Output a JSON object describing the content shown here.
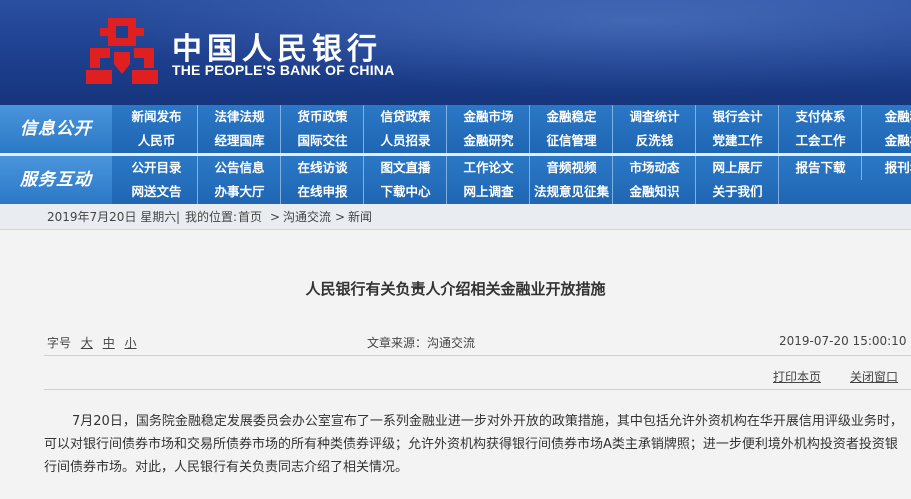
{
  "header": {
    "brand_cn": "中国人民银行",
    "brand_en": "THE PEOPLE'S BANK OF CHINA",
    "logo_icon": "pboc-logo-icon",
    "colors": {
      "banner": "#1d3f8e",
      "logo_red": "#e02020",
      "nav": "#2270bd"
    }
  },
  "nav": {
    "section1_label": "信息公开",
    "section2_label": "服务互动",
    "row1": [
      "新闻发布",
      "法律法规",
      "货币政策",
      "信贷政策",
      "金融市场",
      "金融稳定",
      "调查统计",
      "银行会计",
      "支付体系",
      "金融科"
    ],
    "row2": [
      "人民币",
      "经理国库",
      "国际交往",
      "人员招录",
      "金融研究",
      "征信管理",
      "反洗钱",
      "党建工作",
      "工会工作",
      "金融标"
    ],
    "row3": [
      "公开目录",
      "公告信息",
      "在线访谈",
      "图文直播",
      "工作论文",
      "音频视频",
      "市场动态",
      "网上展厅",
      "报告下载",
      "报刊年"
    ],
    "row4": [
      "网送文告",
      "办事大厅",
      "在线申报",
      "下载中心",
      "网上调查",
      "法规意见征集",
      "金融知识",
      "关于我们"
    ]
  },
  "breadcrumb": {
    "date": "2019年7月20日 星期六",
    "sep": "|",
    "location_label": "我的位置:",
    "home": "首页",
    "arrow": ">",
    "section": "沟通交流",
    "page": "新闻"
  },
  "article": {
    "title": "人民银行有关负责人介绍相关金融业开放措施",
    "font_size_label": "字号",
    "font_sizes": [
      "大",
      "中",
      "小"
    ],
    "source": "文章来源：沟通交流",
    "datetime": "2019-07-20 15:00:10",
    "print_link": "打印本页",
    "close_link": "关闭窗口",
    "body": "7月20日，国务院金融稳定发展委员会办公室宣布了一系列金融业进一步对外开放的政策措施，其中包括允许外资机构在华开展信用评级业务时，可以对银行间债券市场和交易所债券市场的所有种类债券评级；允许外资机构获得银行间债券市场A类主承销牌照；进一步便利境外机构投资者投资银行间债券市场。对此，人民银行有关负责同志介绍了相关情况。"
  }
}
